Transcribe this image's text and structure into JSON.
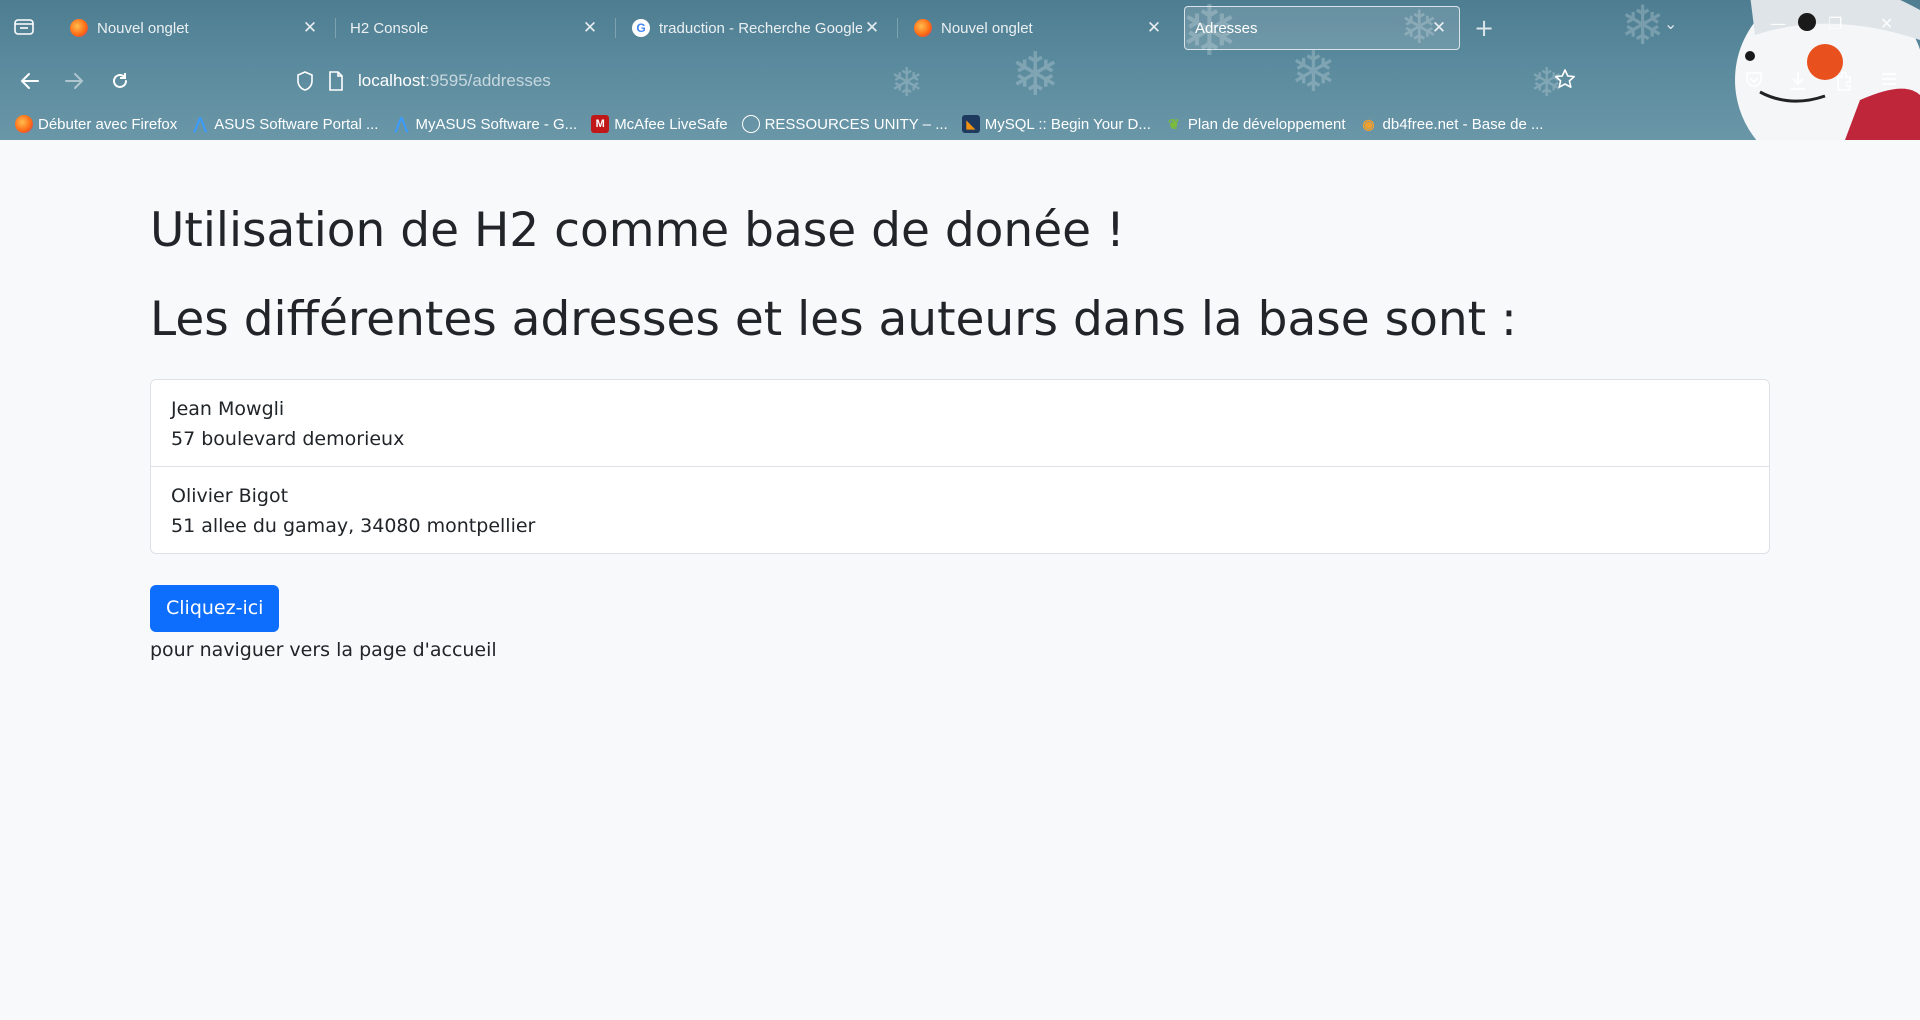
{
  "browser": {
    "tabs": [
      {
        "title": "Nouvel onglet",
        "favicon": "firefox-icon",
        "active": false
      },
      {
        "title": "H2 Console",
        "favicon": "",
        "active": false
      },
      {
        "title": "traduction - Recherche Google",
        "favicon": "google-icon",
        "active": false
      },
      {
        "title": "Nouvel onglet",
        "favicon": "firefox-icon",
        "active": false
      },
      {
        "title": "Adresses",
        "favicon": "",
        "active": true
      }
    ],
    "url_host": "localhost",
    "url_path": ":9595/addresses",
    "bookmarks": [
      {
        "label": "Débuter avec Firefox",
        "icon": "firefox-icon"
      },
      {
        "label": "ASUS Software Portal ...",
        "icon": "asus-icon"
      },
      {
        "label": "MyASUS Software - G...",
        "icon": "asus-icon"
      },
      {
        "label": "McAfee LiveSafe",
        "icon": "mcafee-icon"
      },
      {
        "label": "RESSOURCES UNITY – ...",
        "icon": "globe-icon"
      },
      {
        "label": "MySQL :: Begin Your D...",
        "icon": "mysql-icon"
      },
      {
        "label": "Plan de développement",
        "icon": "leaf-icon"
      },
      {
        "label": "db4free.net - Base de ...",
        "icon": "db4free-icon"
      }
    ]
  },
  "main": {
    "title": "Utilisation de H2 comme base de donée !",
    "subtitle": "Les différentes adresses et les auteurs dans la base sont :",
    "entries": [
      {
        "name": "Jean Mowgli",
        "address": "57 boulevard demorieux"
      },
      {
        "name": "Olivier Bigot",
        "address": "51 allee du gamay, 34080 montpellier"
      }
    ],
    "button_label": "Cliquez-ici",
    "note": "pour naviguer vers la page d'accueil"
  },
  "colors": {
    "primary": "#0d6efd",
    "page_bg": "#f8f9fa",
    "chrome_bg": "#5a8a9d"
  }
}
